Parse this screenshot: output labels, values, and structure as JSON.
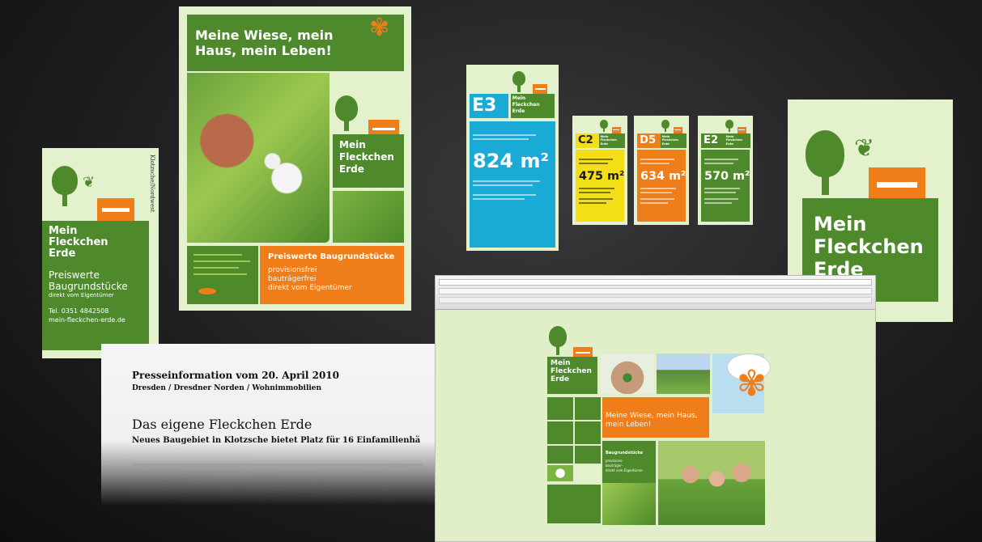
{
  "poster": {
    "headline": "Meine Wiese, mein Haus, mein Leben!",
    "logo_line1": "Mein",
    "logo_line2": "Fleckchen",
    "logo_line3": "Erde",
    "offer_title": "Preiswerte Baugrundstücke",
    "offer_line1": "provisionsfrei",
    "offer_line2": "bauträgerfrei",
    "offer_line3": "direkt vom Eigentümer"
  },
  "flyer": {
    "logo_line1": "Mein",
    "logo_line2": "Fleckchen",
    "logo_line3": "Erde",
    "side_text": "Klotzsche/Nordwest",
    "offer_title1": "Preiswerte",
    "offer_title2": "Baugrundstücke",
    "offer_sub": "direkt vom Eigentümer",
    "phone": "Tel. 0351 4842508",
    "url": "mein-fleckchen-erde.de"
  },
  "signs": [
    {
      "code": "E3",
      "area": "824 m²",
      "color": "#1aaad6",
      "text": "#ffffff"
    },
    {
      "code": "C2",
      "area": "475 m²",
      "color": "#f4df16",
      "text": "#1a1a1a"
    },
    {
      "code": "D5",
      "area": "634 m²",
      "color": "#ef7d1a",
      "text": "#ffffff"
    },
    {
      "code": "E2",
      "area": "570 m²",
      "color": "#4e8a2b",
      "text": "#ffffff"
    }
  ],
  "sign_logo": {
    "line1": "Mein",
    "line2": "Fleckchen",
    "line3": "Erde"
  },
  "logo_card": {
    "line1": "Mein",
    "line2": "Fleckchen",
    "line3": "Erde"
  },
  "press": {
    "line1": "Presseinformation vom 20. April 2010",
    "line2": "Dresden / Dresdner Norden / Wohnimmobilien",
    "title": "Das eigene Fleckchen Erde",
    "subtitle": "Neues Baugebiet in Klotzsche bietet Platz für 16 Einfamilienhä"
  },
  "website": {
    "logo_line1": "Mein",
    "logo_line2": "Fleckchen",
    "logo_line3": "Erde",
    "slogan": "Meine Wiese, mein Haus, mein Leben!",
    "box_title": "Baugrundstücke",
    "box_l1": "provisions-",
    "box_l2": "bauträger-",
    "box_l3": "direkt vom Eigentümer"
  },
  "colors": {
    "green": "#4e8a2b",
    "orange": "#ef7d1a",
    "cream": "#e3f1cc",
    "sky": "#1aaad6"
  }
}
